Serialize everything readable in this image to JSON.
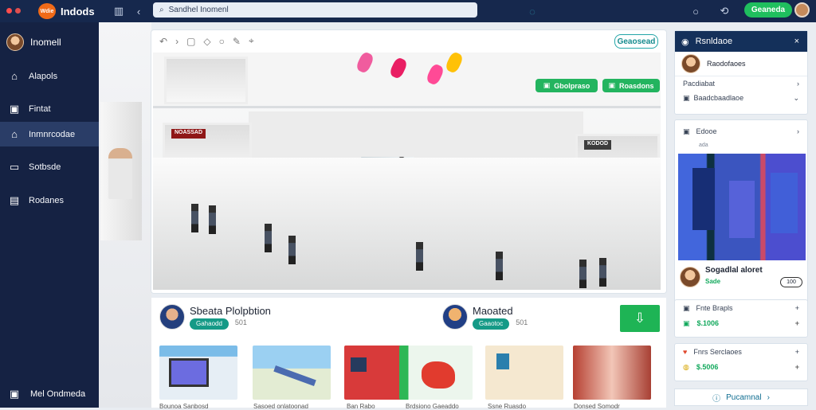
{
  "app": {
    "name": "Indods",
    "logo_text": "Wdie",
    "search_text": "Sandhel Inomenl",
    "primary_action": "Geaneda"
  },
  "colors": {
    "topbar": "#16284d",
    "sidebar": "#152243",
    "active": "#2a3d67",
    "accent": "#1fbf5e",
    "teal": "#159a87"
  },
  "sidebar": {
    "user": "Inomell",
    "items": [
      {
        "label": "Alapols",
        "icon": "home-icon",
        "active": false
      },
      {
        "label": "Fintat",
        "icon": "inbox-icon",
        "active": false
      },
      {
        "label": "Inmnrcodae",
        "icon": "store-icon",
        "active": true
      },
      {
        "label": "Sotbsde",
        "icon": "document-icon",
        "active": false
      },
      {
        "label": "Rodanes",
        "icon": "report-icon",
        "active": false
      }
    ],
    "bottom": "Mel Ondmeda"
  },
  "viewer": {
    "tool_button": "Geaosead",
    "badges": [
      "Gbolpraso",
      "Roasdons"
    ],
    "mall_sign_1": "NOASSAD",
    "mall_sign_2": "KODOD"
  },
  "list": {
    "left_title": "Sbeata Plolpbtion",
    "left_pill": "Gahaodd",
    "left_count": "501",
    "right_title": "Maoated",
    "right_pill": "Gaaotoc",
    "right_count": "501"
  },
  "thumbnails": [
    {
      "caption": "Bounoa Sanbosd"
    },
    {
      "caption": "Sasoed onlatoonad"
    },
    {
      "caption": "Ban Rabo"
    },
    {
      "caption": "Brdsiono Gaeaddo"
    },
    {
      "caption": "Ssne Ruasdo"
    },
    {
      "caption": "Donsed Somodr"
    }
  ],
  "right_panel": {
    "header": "Rsnldaoe",
    "contact": "Raodofaoes",
    "section": "Pacdiabat",
    "section_sub": "Baadcbaadlaoe",
    "feature_title": "Edooe",
    "feature_sub": "ada",
    "feature_name": "Sogadlal aloret",
    "feature_tag": "Sade",
    "feature_count": "100",
    "deals": [
      {
        "title": "Fnte Brapls",
        "price": "$.1006"
      },
      {
        "title": "Fnrs Serclaoes",
        "price": "$.5006"
      }
    ],
    "footer": "Pucamnal"
  }
}
